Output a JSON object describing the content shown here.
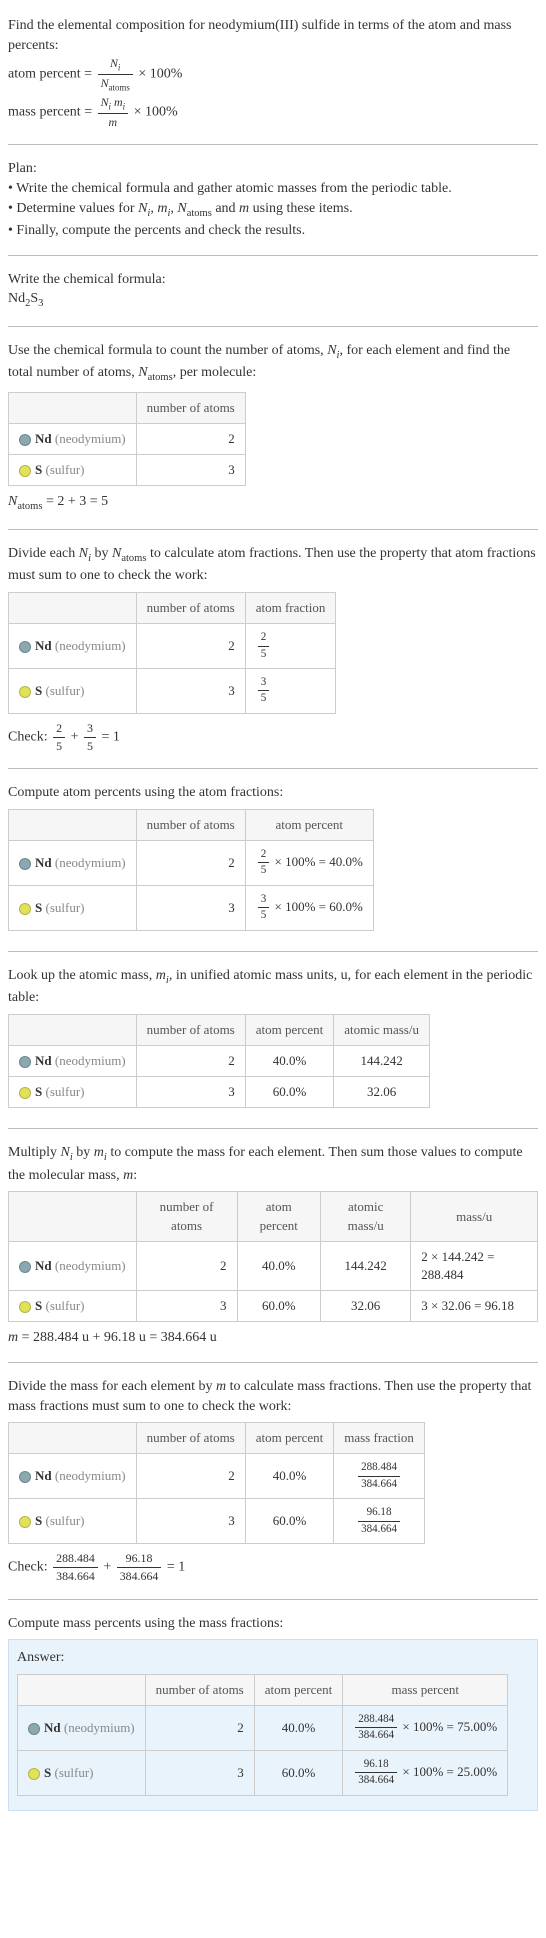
{
  "intro": {
    "line1": "Find the elemental composition for neodymium(III) sulfide in terms of the atom and mass percents:",
    "atom_pct_lhs": "atom percent =",
    "atom_pct_num": "N_i",
    "atom_pct_den": "N_atoms",
    "times100": "× 100%",
    "mass_pct_lhs": "mass percent =",
    "mass_pct_num": "N_i m_i",
    "mass_pct_den": "m"
  },
  "plan": {
    "title": "Plan:",
    "b1": "• Write the chemical formula and gather atomic masses from the periodic table.",
    "b2a": "• Determine values for ",
    "b2b": " using these items.",
    "b3": "• Finally, compute the percents and check the results."
  },
  "chem": {
    "title": "Write the chemical formula:",
    "formula_a": "Nd",
    "formula_b": "2",
    "formula_c": "S",
    "formula_d": "3"
  },
  "natoms_section": {
    "text_a": "Use the chemical formula to count the number of atoms, ",
    "text_b": ", for each element and find the total number of atoms, ",
    "text_c": ", per molecule:",
    "Ni": "N_i",
    "Natoms": "N_atoms"
  },
  "headers": {
    "num_atoms": "number of atoms",
    "atom_fraction": "atom fraction",
    "atom_percent": "atom percent",
    "atomic_mass": "atomic mass/u",
    "mass_u": "mass/u",
    "mass_fraction": "mass fraction",
    "mass_percent": "mass percent"
  },
  "el": {
    "nd_sym": "Nd",
    "nd_name": "(neodymium)",
    "s_sym": "S",
    "s_name": "(sulfur)"
  },
  "t1": {
    "nd": "2",
    "s": "3"
  },
  "natoms_eq": "N_atoms = 2 + 3 = 5",
  "frac_section": {
    "text_a": "Divide each ",
    "text_b": " by ",
    "text_c": " to calculate atom fractions. Then use the property that atom fractions must sum to one to check the work:"
  },
  "t2": {
    "nd_n": "2",
    "nd_f_num": "2",
    "nd_f_den": "5",
    "s_n": "3",
    "s_f_num": "3",
    "s_f_den": "5"
  },
  "check1_a": "Check: ",
  "check1_eq_n1": "2",
  "check1_eq_d1": "5",
  "check1_plus": " + ",
  "check1_eq_n2": "3",
  "check1_eq_d2": "5",
  "check1_eq_end": " = 1",
  "pct_section": "Compute atom percents using the atom fractions:",
  "t3": {
    "nd_n": "2",
    "nd_pct_num": "2",
    "nd_pct_den": "5",
    "nd_pct_rest": " × 100% = 40.0%",
    "s_n": "3",
    "s_pct_num": "3",
    "s_pct_den": "5",
    "s_pct_rest": " × 100% = 60.0%"
  },
  "mass_lookup": "Look up the atomic mass, m_i, in unified atomic mass units, u, for each element in the periodic table:",
  "t4": {
    "nd_n": "2",
    "nd_pct": "40.0%",
    "nd_mass": "144.242",
    "s_n": "3",
    "s_pct": "60.0%",
    "s_mass": "32.06"
  },
  "mult_section": "Multiply N_i by m_i to compute the mass for each element. Then sum those values to compute the molecular mass, m:",
  "t5": {
    "nd_n": "2",
    "nd_pct": "40.0%",
    "nd_mass": "144.242",
    "nd_prod": "2 × 144.242 = 288.484",
    "s_n": "3",
    "s_pct": "60.0%",
    "s_mass": "32.06",
    "s_prod": "3 × 32.06 = 96.18"
  },
  "m_eq": "m = 288.484 u + 96.18 u = 384.664 u",
  "massfrac_section": "Divide the mass for each element by m to calculate mass fractions. Then use the property that mass fractions must sum to one to check the work:",
  "t6": {
    "nd_n": "2",
    "nd_pct": "40.0%",
    "nd_f_num": "288.484",
    "nd_f_den": "384.664",
    "s_n": "3",
    "s_pct": "60.0%",
    "s_f_num": "96.18",
    "s_f_den": "384.664"
  },
  "check2_a": "Check: ",
  "check2_n1": "288.484",
  "check2_d1": "384.664",
  "check2_plus": " + ",
  "check2_n2": "96.18",
  "check2_d2": "384.664",
  "check2_end": " = 1",
  "masspct_section": "Compute mass percents using the mass fractions:",
  "answer": {
    "title": "Answer:",
    "nd_n": "2",
    "nd_pct": "40.0%",
    "nd_mnum": "288.484",
    "nd_mden": "384.664",
    "nd_rest": " × 100% = 75.00%",
    "s_n": "3",
    "s_pct": "60.0%",
    "s_mnum": "96.18",
    "s_mden": "384.664",
    "s_rest": " × 100% = 25.00%"
  }
}
